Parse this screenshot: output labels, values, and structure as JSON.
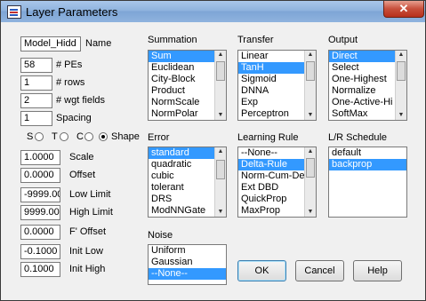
{
  "window": {
    "title": "Layer Parameters",
    "close_glyph": "✕"
  },
  "fields": {
    "name_value": "Model_Hidd",
    "name_label": "Name",
    "pes_value": "58",
    "pes_label": "# PEs",
    "rows_value": "1",
    "rows_label": "# rows",
    "wgt_value": "2",
    "wgt_label": "# wgt fields",
    "spacing_value": "1",
    "spacing_label": "Spacing",
    "scale_value": "1.0000",
    "scale_label": "Scale",
    "offset_value": "0.0000",
    "offset_label": "Offset",
    "lowlimit_value": "-9999.00",
    "lowlimit_label": "Low Limit",
    "highlimit_value": "9999.000",
    "highlimit_label": "High Limit",
    "foffset_value": "0.0000",
    "foffset_label": "F' Offset",
    "initlow_value": "-0.1000",
    "initlow_label": "Init Low",
    "inithigh_value": "0.1000",
    "inithigh_label": "Init High"
  },
  "shape": {
    "s": "S",
    "t": "T",
    "c": "C",
    "label": "Shape",
    "selected": "Shape"
  },
  "summation": {
    "label": "Summation",
    "items": [
      "Sum",
      "Euclidean",
      "City-Block",
      "Product",
      "NormScale",
      "NormPolar"
    ],
    "selected": "Sum"
  },
  "transfer": {
    "label": "Transfer",
    "items": [
      "Linear",
      "TanH",
      "Sigmoid",
      "DNNA",
      "Exp",
      "Perceptron"
    ],
    "selected": "TanH"
  },
  "output": {
    "label": "Output",
    "items": [
      "Direct",
      "Select",
      "One-Highest",
      "Normalize",
      "One-Active-Hi",
      "SoftMax"
    ],
    "selected": "Direct"
  },
  "error": {
    "label": "Error",
    "items": [
      "standard",
      "quadratic",
      "cubic",
      "tolerant",
      "DRS",
      "ModNNGate"
    ],
    "selected": "standard"
  },
  "learning_rule": {
    "label": "Learning Rule",
    "items": [
      "--None--",
      "Delta-Rule",
      "Norm-Cum-De",
      "Ext DBD",
      "QuickProp",
      "MaxProp"
    ],
    "selected": "Delta-Rule"
  },
  "lr_schedule": {
    "label": "L/R Schedule",
    "items": [
      "default",
      "backprop"
    ],
    "selected": "backprop"
  },
  "noise": {
    "label": "Noise",
    "items": [
      "Uniform",
      "Gaussian",
      "--None--"
    ],
    "selected": "--None--"
  },
  "buttons": {
    "ok": "OK",
    "cancel": "Cancel",
    "help": "Help"
  }
}
